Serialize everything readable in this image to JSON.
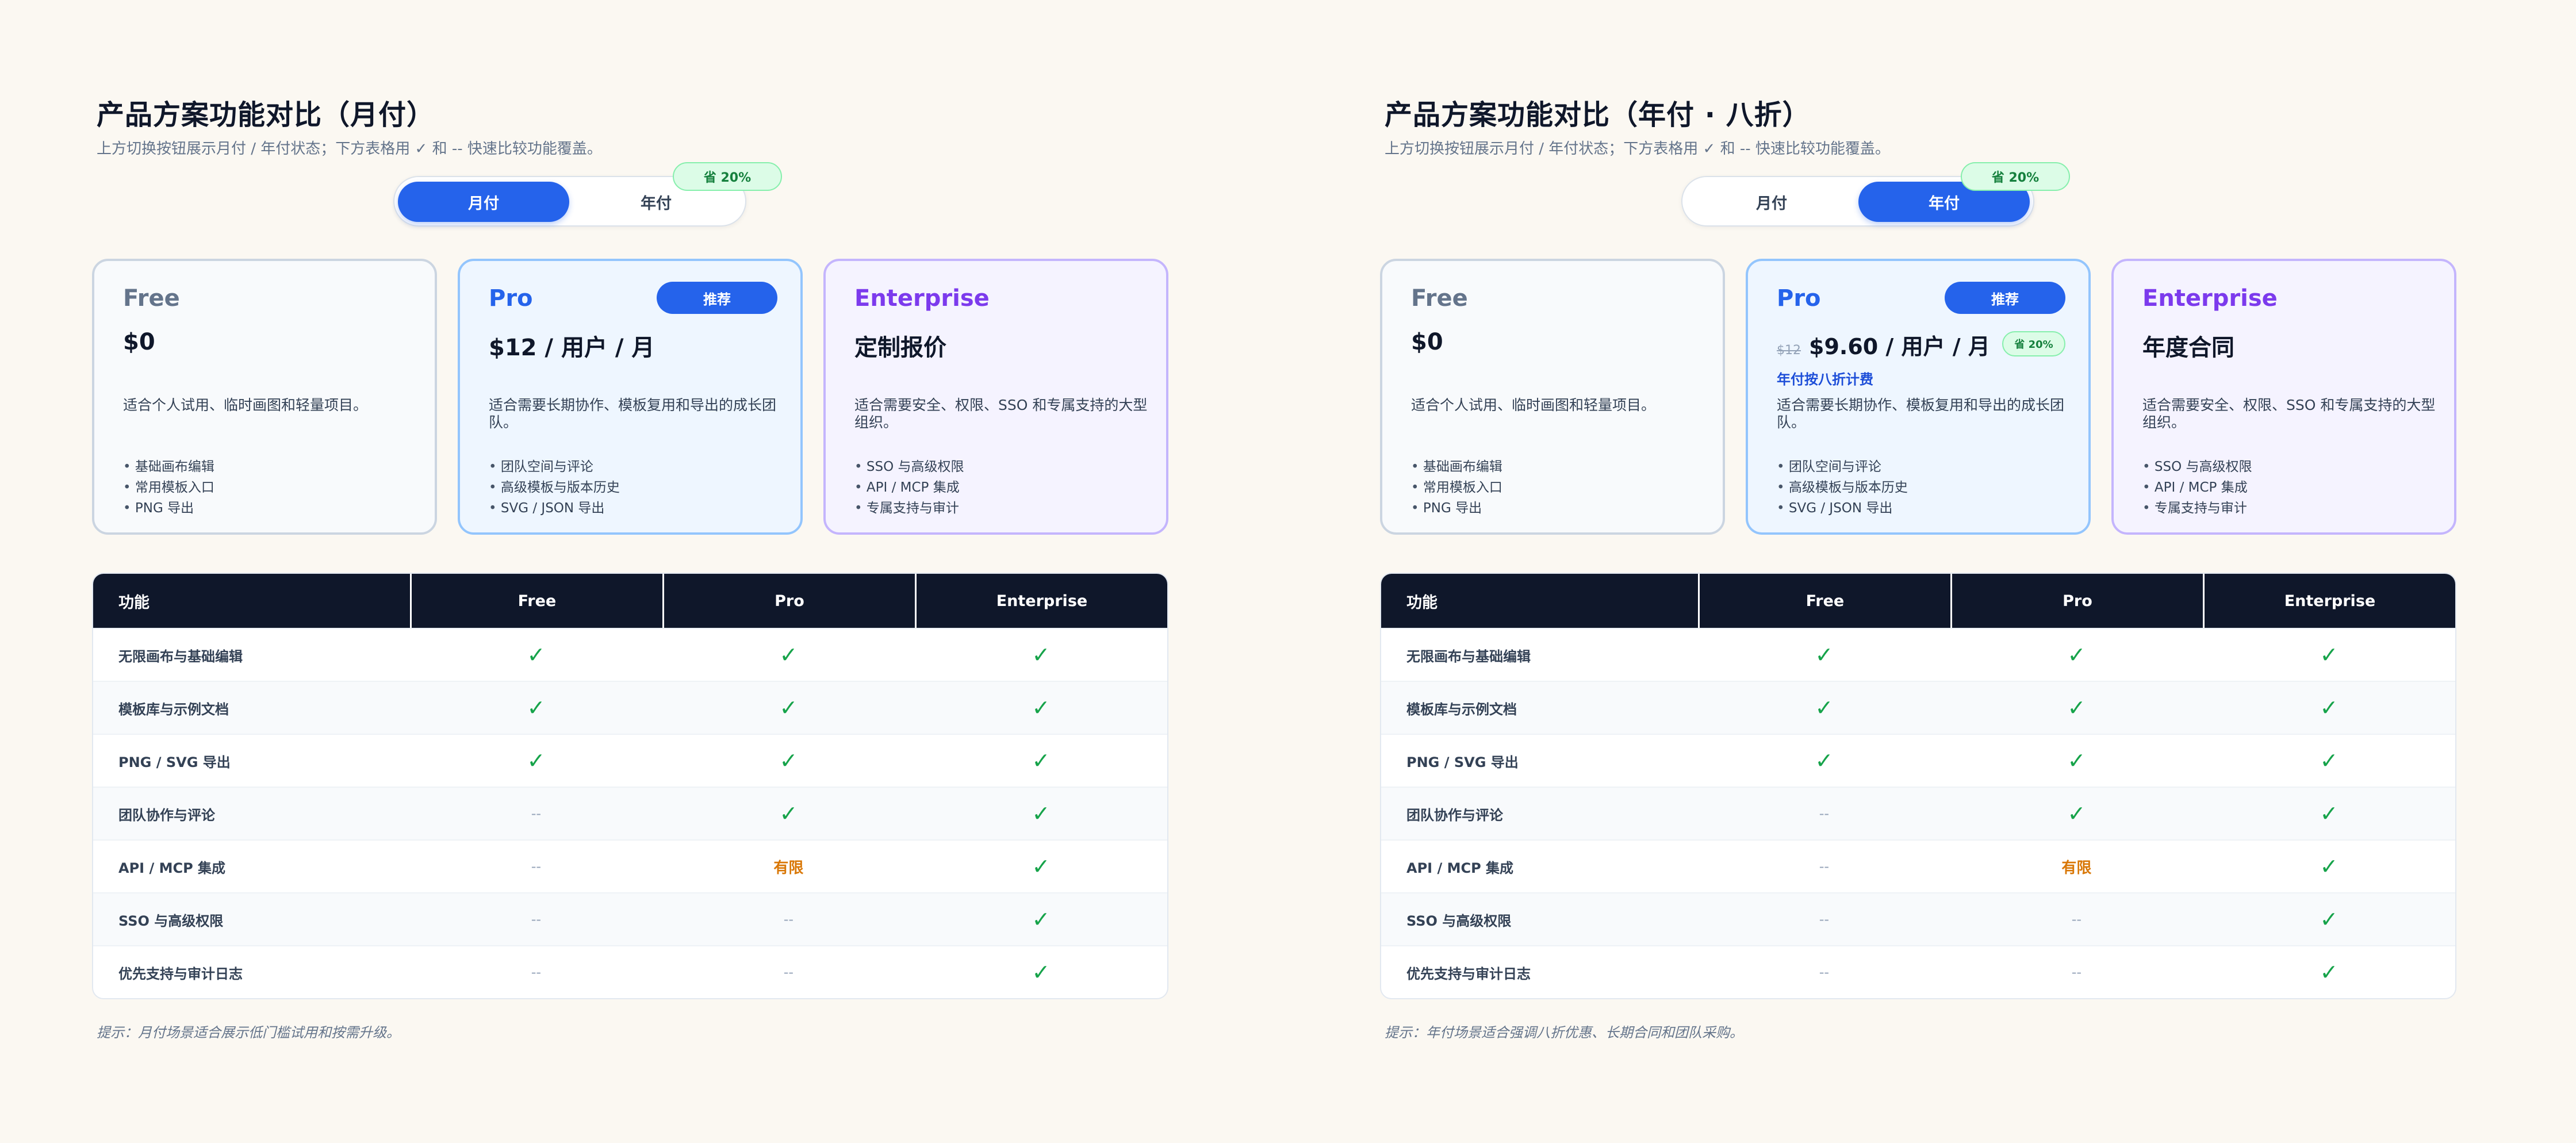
{
  "colors": {
    "background": "#fbf8f2",
    "accent": "#2563eb",
    "check": "#16a34a",
    "limited": "#d97706",
    "dash": "#94a3b8",
    "header_bg": "#0f172a",
    "save_green": "#15803d",
    "enterprise_purple": "#7c3aed"
  },
  "table_headers": [
    "功能",
    "Free",
    "Pro",
    "Enterprise"
  ],
  "feature_rows": [
    {
      "name": "无限画布与基础编辑",
      "values": [
        "check",
        "check",
        "check"
      ]
    },
    {
      "name": "模板库与示例文档",
      "values": [
        "check",
        "check",
        "check"
      ]
    },
    {
      "name": "PNG / SVG 导出",
      "values": [
        "check",
        "check",
        "check"
      ]
    },
    {
      "name": "团队协作与评论",
      "values": [
        "dash",
        "check",
        "check"
      ]
    },
    {
      "name": "API / MCP 集成",
      "values": [
        "dash",
        "limited",
        "check"
      ]
    },
    {
      "name": "SSO 与高级权限",
      "values": [
        "dash",
        "dash",
        "check"
      ]
    },
    {
      "name": "优先支持与审计日志",
      "values": [
        "dash",
        "dash",
        "check"
      ]
    }
  ],
  "value_symbols": {
    "check": "✓",
    "dash": "--",
    "limited": "有限"
  },
  "monthly": {
    "title": "产品方案功能对比（月付）",
    "subtitle": "上方切换按钮展示月付 / 年付状态；下方表格用 ✓ 和 -- 快速比较功能覆盖。",
    "toggle": {
      "monthly_label": "月付",
      "yearly_label": "年付",
      "active": "monthly"
    },
    "save_badge": "省 20%",
    "plans": {
      "free": {
        "name": "Free",
        "price": "$0",
        "desc": "适合个人试用、临时画图和轻量项目。",
        "features": [
          "基础画布编辑",
          "常用模板入口",
          "PNG 导出"
        ]
      },
      "pro": {
        "name": "Pro",
        "badge": "推荐",
        "price": "$12 / 用户 / 月",
        "desc": "适合需要长期协作、模板复用和导出的成长团队。",
        "features": [
          "团队空间与评论",
          "高级模板与版本历史",
          "SVG / JSON 导出"
        ]
      },
      "enterprise": {
        "name": "Enterprise",
        "price": "定制报价",
        "desc": "适合需要安全、权限、SSO 和专属支持的大型组织。",
        "features": [
          "SSO 与高级权限",
          "API / MCP 集成",
          "专属支持与审计"
        ]
      }
    },
    "footnote": "提示：月付场景适合展示低门槛试用和按需升级。"
  },
  "yearly": {
    "title": "产品方案功能对比（年付 · 八折）",
    "subtitle": "上方切换按钮展示月付 / 年付状态；下方表格用 ✓ 和 -- 快速比较功能覆盖。",
    "toggle": {
      "monthly_label": "月付",
      "yearly_label": "年付",
      "active": "yearly"
    },
    "save_badge": "省 20%",
    "plans": {
      "free": {
        "name": "Free",
        "price": "$0",
        "desc": "适合个人试用、临时画图和轻量项目。",
        "features": [
          "基础画布编辑",
          "常用模板入口",
          "PNG 导出"
        ]
      },
      "pro": {
        "name": "Pro",
        "badge": "推荐",
        "old_price": "$12",
        "price": "$9.60 / 用户 / 月",
        "mini_save": "省 20%",
        "price_note": "年付按八折计费",
        "desc": "适合需要长期协作、模板复用和导出的成长团队。",
        "features": [
          "团队空间与评论",
          "高级模板与版本历史",
          "SVG / JSON 导出"
        ]
      },
      "enterprise": {
        "name": "Enterprise",
        "price": "年度合同",
        "desc": "适合需要安全、权限、SSO 和专属支持的大型组织。",
        "features": [
          "SSO 与高级权限",
          "API / MCP 集成",
          "专属支持与审计"
        ]
      }
    },
    "footnote": "提示：年付场景适合强调八折优惠、长期合同和团队采购。"
  }
}
